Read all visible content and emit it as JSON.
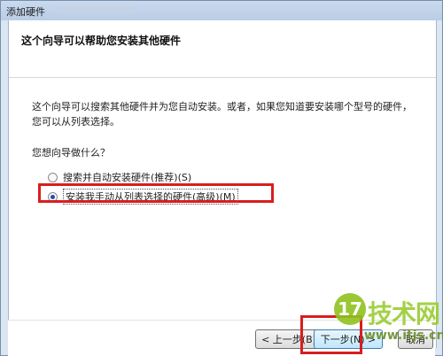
{
  "window": {
    "title": "添加硬件"
  },
  "header": {
    "title": "这个向导可以帮助您安装其他硬件"
  },
  "content": {
    "description": "这个向导可以搜索其他硬件并为您自动安装。或者，如果您知道要安装哪个型号的硬件，您可以从列表选择。",
    "question": "您想向导做什么？",
    "options": [
      {
        "label": "搜索并自动安装硬件(推荐)(S)",
        "checked": false
      },
      {
        "label": "安装我手动从列表选择的硬件(高级)(M)",
        "checked": true
      }
    ]
  },
  "footer": {
    "back_label": "< 上一步(B)",
    "next_label": "下一步(N) >",
    "cancel_label": "取消"
  },
  "watermark": {
    "logo_char": "17",
    "text": "技术网",
    "url": "www.itjs.cn"
  },
  "colors": {
    "highlight": "#d81e1e",
    "watermark": "#9acd32"
  }
}
